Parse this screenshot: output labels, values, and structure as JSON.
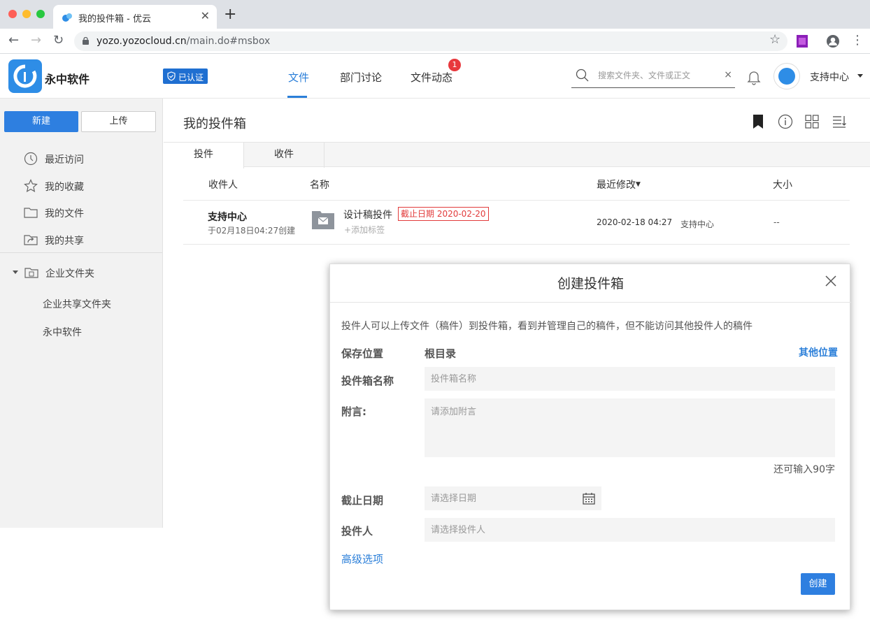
{
  "browser": {
    "tab_title": "我的投件箱 - 优云",
    "url_host": "yozo.yozocloud.cn",
    "url_path": "/main.do#msbox",
    "traffic_colors": [
      "#fe5f57",
      "#febc2e",
      "#28c840"
    ]
  },
  "header": {
    "brand": "永中软件",
    "certified": "已认证",
    "nav": [
      {
        "label": "文件",
        "active": true
      },
      {
        "label": "部门讨论",
        "active": false
      },
      {
        "label": "文件动态",
        "active": false
      }
    ],
    "notification_count": "1",
    "search_placeholder": "搜索文件夹、文件或正文",
    "search_clear": "×",
    "username": "支持中心"
  },
  "sidebar": {
    "new_button": "新建",
    "upload_button": "上传",
    "items": [
      {
        "label": "最近访问",
        "icon": "clock-icon"
      },
      {
        "label": "我的收藏",
        "icon": "star-icon"
      },
      {
        "label": "我的文件",
        "icon": "folder-icon"
      },
      {
        "label": "我的共享",
        "icon": "share-icon"
      }
    ],
    "enterprise": {
      "label": "企业文件夹",
      "children": [
        "企业共享文件夹",
        "永中软件"
      ]
    }
  },
  "main": {
    "title": "我的投件箱",
    "tabs": [
      {
        "label": "投件",
        "active": true
      },
      {
        "label": "收件",
        "active": false
      }
    ],
    "columns": {
      "recipient": "收件人",
      "name": "名称",
      "modified": "最近修改",
      "size": "大小"
    },
    "rows": [
      {
        "owner": "支持中心",
        "created": "于02月18日04:27创建",
        "name": "设计稿投件",
        "deadline": "截止日期 2020-02-20",
        "add_tag": "添加标签",
        "modified_date": "2020-02-18 04:27",
        "modifier": "支持中心",
        "size": "--"
      }
    ]
  },
  "modal": {
    "title": "创建投件箱",
    "description": "投件人可以上传文件（稿件）到投件箱，看到并管理自己的稿件，但不能访问其他投件人的稿件",
    "save_location_label": "保存位置",
    "save_location_value": "根目录",
    "other_location": "其他位置",
    "name_label": "投件箱名称",
    "name_placeholder": "投件箱名称",
    "note_label": "附言:",
    "note_placeholder": "请添加附言",
    "remaining": "还可输入90字",
    "deadline_label": "截止日期",
    "deadline_placeholder": "请选择日期",
    "submitter_label": "投件人",
    "submitter_placeholder": "请选择投件人",
    "advanced": "高级选项",
    "create_button": "创建"
  },
  "colors": {
    "accent": "#2b7fd9",
    "primary_button": "#2e7fe0",
    "deadline_red": "#e23b3b",
    "badge_red": "#e8383d"
  }
}
